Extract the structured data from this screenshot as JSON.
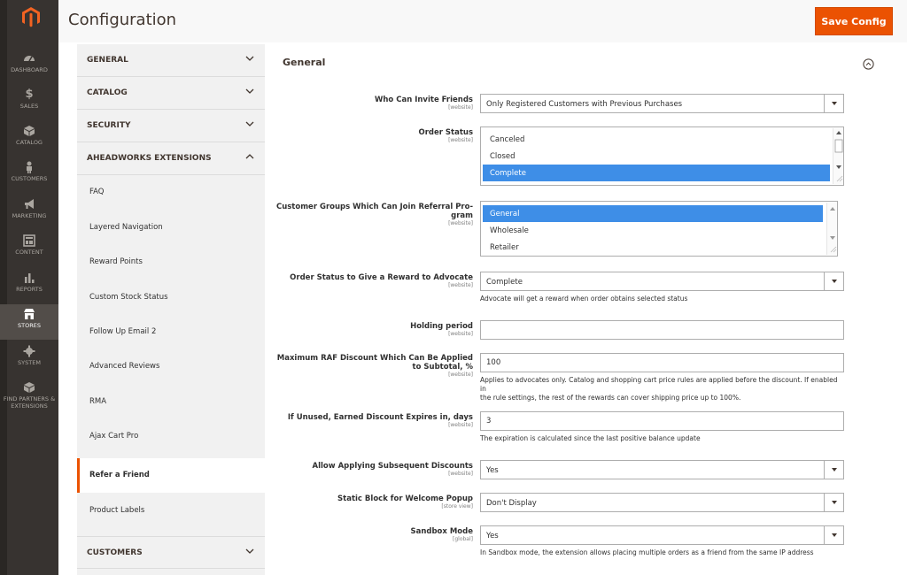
{
  "admin_nav": {
    "items": [
      {
        "label": "DASHBOARD",
        "icon": "dashboard-icon"
      },
      {
        "label": "SALES",
        "icon": "dollar-icon"
      },
      {
        "label": "CATALOG",
        "icon": "cube-icon"
      },
      {
        "label": "CUSTOMERS",
        "icon": "person-icon"
      },
      {
        "label": "MARKETING",
        "icon": "megaphone-icon"
      },
      {
        "label": "CONTENT",
        "icon": "layout-icon"
      },
      {
        "label": "REPORTS",
        "icon": "bar-chart-icon"
      },
      {
        "label": "STORES",
        "icon": "store-icon"
      },
      {
        "label": "SYSTEM",
        "icon": "gear-icon"
      },
      {
        "label": "FIND PARTNERS & EXTENSIONS",
        "icon": "box-icon"
      }
    ],
    "active": "STORES"
  },
  "header": {
    "title": "Configuration",
    "save_label": "Save Config"
  },
  "config_tabs": {
    "general": "GENERAL",
    "catalog": "CATALOG",
    "security": "SECURITY",
    "aheadworks": "AHEADWORKS EXTENSIONS",
    "customers": "CUSTOMERS",
    "items": [
      "FAQ",
      "Layered Navigation",
      "Reward Points",
      "Custom Stock Status",
      "Follow Up Email 2",
      "Advanced Reviews",
      "RMA",
      "Ajax Cart Pro",
      "Refer a Friend",
      "Product Labels"
    ],
    "active_item": "Refer a Friend"
  },
  "section": {
    "title": "General"
  },
  "fields": {
    "who_can_invite": {
      "label": "Who Can Invite Friends",
      "scope": "[website]",
      "value": "Only Registered Customers with Previous Purchases"
    },
    "order_status": {
      "label": "Order Status",
      "scope": "[website]",
      "options": [
        "Canceled",
        "Closed",
        "Complete"
      ],
      "selected": "Complete"
    },
    "customer_groups": {
      "label_line1": "Customer Groups Which Can Join Referral Pro-",
      "label_line2": "gram",
      "scope": "[website]",
      "options": [
        "General",
        "Wholesale",
        "Retailer"
      ],
      "selected": "General"
    },
    "reward_status": {
      "label": "Order Status to Give a Reward to Advocate",
      "scope": "[website]",
      "value": "Complete",
      "note": "Advocate will get a reward when order obtains selected status"
    },
    "holding_period": {
      "label": "Holding period",
      "scope": "[website]",
      "value": ""
    },
    "max_discount": {
      "label_line1": "Maximum RAF Discount Which Can Be Applied",
      "label_line2": "to Subtotal, %",
      "scope": "[website]",
      "value": "100",
      "note_line1": "Applies to advocates only. Catalog and shopping cart price rules are applied before the discount. If enabled in",
      "note_line2": "the rule settings, the rest of the rewards can cover shipping price up to 100%."
    },
    "expires": {
      "label": "If Unused, Earned Discount Expires in, days",
      "scope": "[website]",
      "value": "3",
      "note": "The expiration is calculated since the last positive balance update"
    },
    "subsequent": {
      "label": "Allow Applying Subsequent Discounts",
      "scope": "[website]",
      "value": "Yes"
    },
    "static_block": {
      "label": "Static Block for Welcome Popup",
      "scope": "[store view]",
      "value": "Don't Display"
    },
    "sandbox": {
      "label": "Sandbox Mode",
      "scope": "[global]",
      "value": "Yes",
      "note": "In Sandbox mode, the extension allows placing multiple orders as a friend from the same IP address"
    }
  },
  "colors": {
    "accent": "#eb5202",
    "sidebar": "#373330",
    "selected_option": "#3e8ee7"
  }
}
